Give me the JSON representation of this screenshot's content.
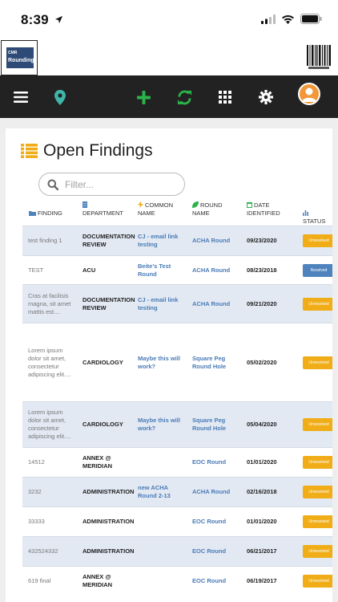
{
  "status_bar": {
    "time": "8:39"
  },
  "logo": {
    "line1": "CMR",
    "line2": "Rounding"
  },
  "nav": {
    "menu_icon": "hamburger-menu-icon",
    "location_icon": "map-pin-icon",
    "add_icon": "plus-icon",
    "sync_icon": "refresh-icon",
    "apps_icon": "grid-icon",
    "settings_icon": "gear-icon"
  },
  "page": {
    "title": "Open Findings",
    "filter_placeholder": "Filter..."
  },
  "table": {
    "headers": {
      "finding": "FINDING",
      "department": "DEPARTMENT",
      "common_name": "COMMON NAME",
      "round_name": "ROUND NAME",
      "date_identified": "DATE IDENTIFIED",
      "status": "STATUS"
    },
    "rows": [
      {
        "finding": "test finding 1",
        "department": "DOCUMENTATION REVIEW",
        "common_name": "CJ - email link testing",
        "round_name": "ACHA Round",
        "date": "09/23/2020",
        "status": "Unresolved"
      },
      {
        "finding": "TEST",
        "department": "ACU",
        "common_name": "Beite's Test Round",
        "round_name": "ACHA Round",
        "date": "08/23/2018",
        "status": "Resolved"
      },
      {
        "finding": "Cras at facilisis magna, sit amet mattis est....",
        "department": "DOCUMENTATION REVIEW",
        "common_name": "CJ - email link testing",
        "round_name": "ACHA Round",
        "date": "09/21/2020",
        "status": "Unresolved"
      },
      {
        "finding": "Lorem ipsum dolor sit amet, consectetur adipiscing elit....",
        "department": "CARDIOLOGY",
        "common_name": "Maybe this will work?",
        "round_name": "Square Peg Round Hole",
        "date": "05/02/2020",
        "status": "Unresolved"
      },
      {
        "finding": "Lorem ipsum dolor sit amet, consectetur adipiscing elit....",
        "department": "CARDIOLOGY",
        "common_name": "Maybe this will work?",
        "round_name": "Square Peg Round Hole",
        "date": "05/04/2020",
        "status": "Unresolved"
      },
      {
        "finding": "14512",
        "department": "ANNEX @ MERIDIAN",
        "common_name": "",
        "round_name": "EOC Round",
        "date": "01/01/2020",
        "status": "Unresolved"
      },
      {
        "finding": "3232",
        "department": "ADMINISTRATION",
        "common_name": "new ACHA Round 2-13",
        "round_name": "ACHA Round",
        "date": "02/16/2018",
        "status": "Unresolved"
      },
      {
        "finding": "33333",
        "department": "ADMINISTRATION",
        "common_name": "",
        "round_name": "EOC Round",
        "date": "01/01/2020",
        "status": "Unresolved"
      },
      {
        "finding": "432524332",
        "department": "ADMINISTRATION",
        "common_name": "",
        "round_name": "EOC Round",
        "date": "06/21/2017",
        "status": "Unresolved"
      },
      {
        "finding": "619 final",
        "department": "ANNEX @ MERIDIAN",
        "common_name": "",
        "round_name": "EOC Round",
        "date": "06/19/2017",
        "status": "Unresolved"
      }
    ]
  },
  "colors": {
    "navbar": "#222222",
    "accent_orange": "#f0ad18",
    "link_blue": "#4a7bb7",
    "resolved_blue": "#4f83bd",
    "pin_teal": "#3fb6a8",
    "add_green": "#2ab34a"
  }
}
